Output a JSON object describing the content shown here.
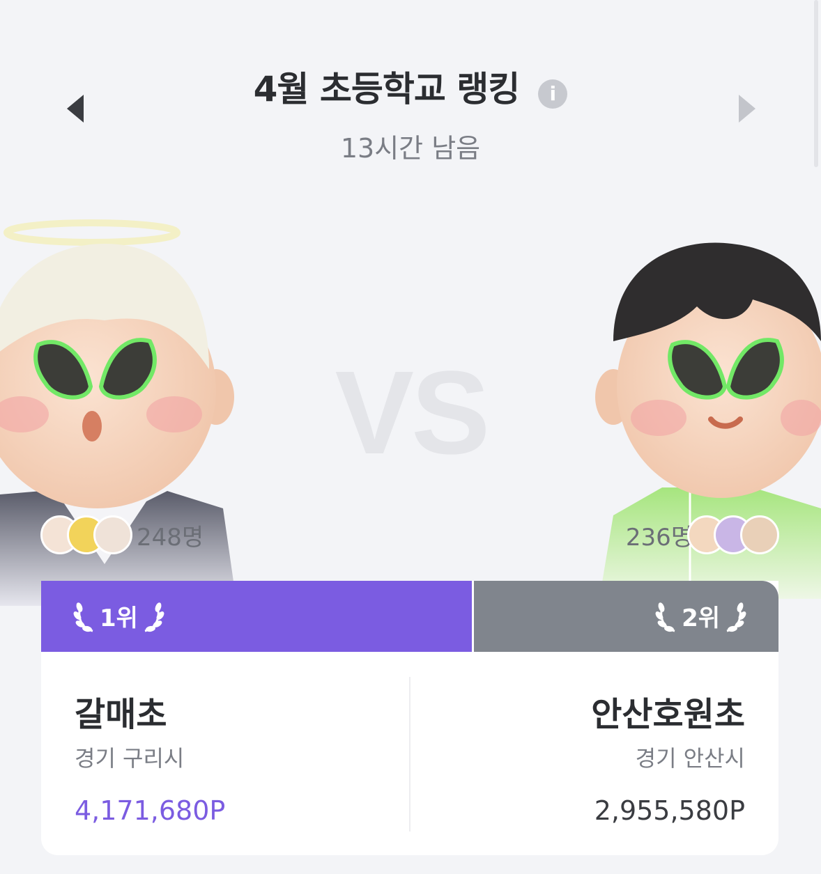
{
  "header": {
    "title": "4월 초등학교 랭킹",
    "info_glyph": "i",
    "time_left": "13시간 남음"
  },
  "vs_text": "VS",
  "left": {
    "rank_label": "1위",
    "member_count": "248명",
    "school_name": "갈매초",
    "location": "경기 구리시",
    "points": "4,171,680P"
  },
  "right": {
    "rank_label": "2위",
    "member_count": "236명",
    "school_name": "안산호원초",
    "location": "경기 안산시",
    "points": "2,955,580P"
  },
  "colors": {
    "first_place": "#7b5ce1",
    "second_place": "#80858d",
    "background": "#f3f4f7"
  },
  "icons": [
    "info-icon",
    "prev-arrow-icon",
    "next-arrow-icon",
    "laurel-icon"
  ]
}
